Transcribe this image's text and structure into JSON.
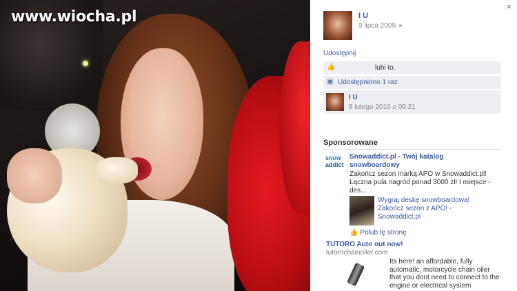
{
  "photo": {
    "watermark": "www.wiocha.pl"
  },
  "panel": {
    "close_label": "×",
    "owner": {
      "name": "I     U",
      "date": "9 lipca 2009",
      "privacy_icon": "globe-icon"
    },
    "share_label": "Udostępnij",
    "likes_text": "lubi to.",
    "shares_text": "Udostępniono 1 raz",
    "share_item": {
      "name": "I     U",
      "date": "8 lutego 2010 o 09:21"
    },
    "sponsored_title": "Sponsorowane",
    "ads": [
      {
        "logo_top": "snow",
        "logo_bottom": "addict",
        "title": "Snowaddict.pl - Twój katalog snowboardowy",
        "body": "Zakończ sezon marką APO w Snowaddict.pl! Łączna pula nagród ponad 3000 zł! I miejsce - des...",
        "sub_text": "Wygraj deskę snowboardową! Zakończ sezon z APO! - Snowaddict.pl",
        "like_label": "Polub tę stronę"
      },
      {
        "title": "TUTORO Auto out now!",
        "url": "tutorochainoiler.com",
        "body": "Its here! an affordable, fully automatic, motorcycle chain oiler that you dont need to connect to the engine or electrical system"
      }
    ]
  },
  "colors": {
    "link": "#3b5998",
    "ufi_bg": "#edeff4"
  }
}
